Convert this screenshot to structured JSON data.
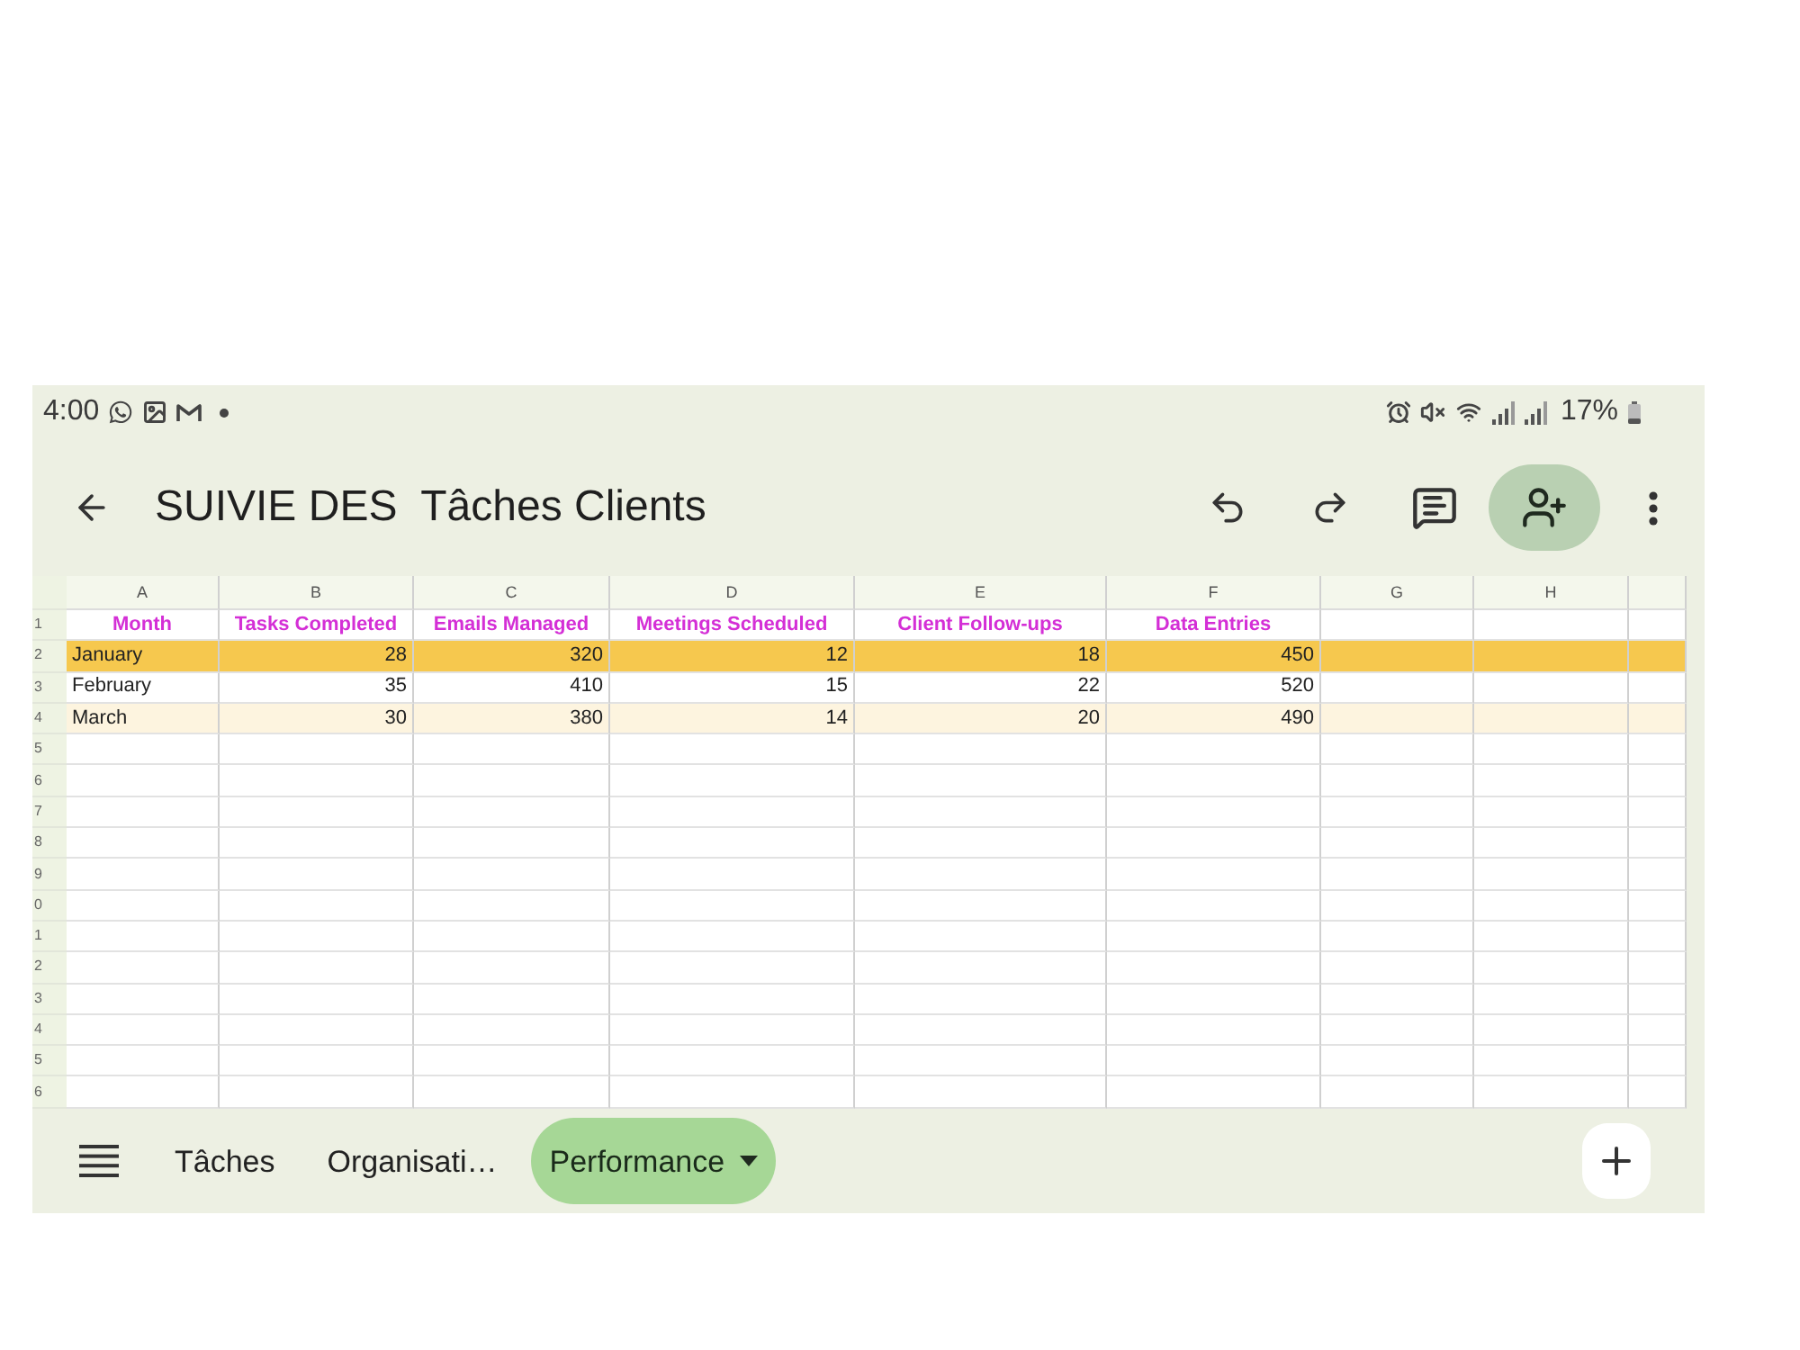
{
  "status_bar": {
    "time": "4:00",
    "battery": "17%"
  },
  "toolbar": {
    "title": "SUIVIE DES  Tâches Clients"
  },
  "sheet": {
    "columns": [
      "A",
      "B",
      "C",
      "D",
      "E",
      "F",
      "G",
      "H"
    ],
    "rows": [
      {
        "number": "1",
        "kind": "header",
        "color": "#ffffff",
        "cells": [
          "Month",
          "Tasks Completed",
          "Emails Managed",
          "Meetings Scheduled",
          "Client Follow-ups",
          "Data Entries"
        ]
      },
      {
        "number": "2",
        "kind": "data",
        "color": "#f6c84e",
        "cells": [
          "January",
          "28",
          "320",
          "12",
          "18",
          "450"
        ]
      },
      {
        "number": "3",
        "kind": "data",
        "color": "#ffffff",
        "cells": [
          "February",
          "35",
          "410",
          "15",
          "22",
          "520"
        ]
      },
      {
        "number": "4",
        "kind": "data",
        "color": "#fdf4df",
        "cells": [
          "March",
          "30",
          "380",
          "14",
          "20",
          "490"
        ]
      },
      {
        "number": "5",
        "kind": "empty"
      },
      {
        "number": "6",
        "kind": "empty"
      },
      {
        "number": "7",
        "kind": "empty"
      },
      {
        "number": "8",
        "kind": "empty"
      },
      {
        "number": "9",
        "kind": "empty"
      },
      {
        "number": "0",
        "kind": "empty"
      },
      {
        "number": "1",
        "kind": "empty"
      },
      {
        "number": "2",
        "kind": "empty"
      },
      {
        "number": "3",
        "kind": "empty"
      },
      {
        "number": "4",
        "kind": "empty"
      },
      {
        "number": "5",
        "kind": "empty"
      },
      {
        "number": "6",
        "kind": "empty"
      }
    ]
  },
  "sheet_tabs": [
    {
      "label": "Tâches",
      "selected": false
    },
    {
      "label": "Organisati…",
      "selected": false
    },
    {
      "label": "Performance",
      "selected": true
    }
  ]
}
